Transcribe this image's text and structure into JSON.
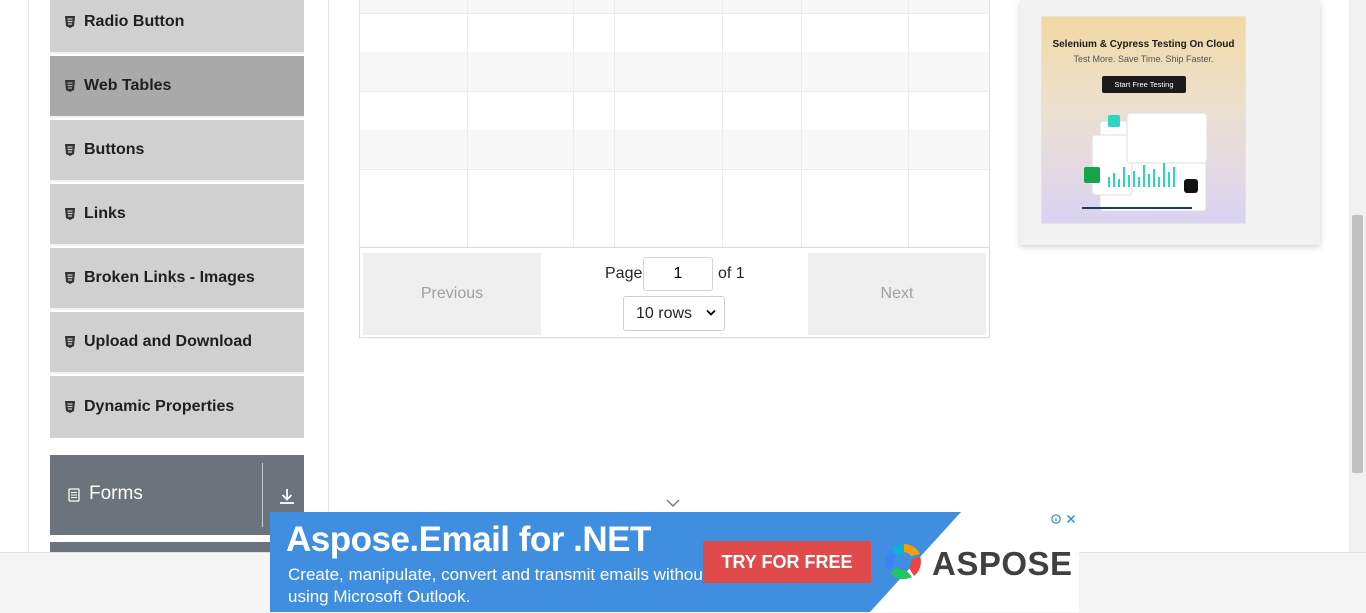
{
  "sidebar": {
    "items": [
      {
        "label": "Radio Button"
      },
      {
        "label": "Web Tables"
      },
      {
        "label": "Buttons"
      },
      {
        "label": "Links"
      },
      {
        "label": "Broken Links - Images"
      },
      {
        "label": "Upload and Download"
      },
      {
        "label": "Dynamic Properties"
      }
    ],
    "active_item": "Web Tables",
    "group": {
      "label": "Forms"
    }
  },
  "table": {
    "empty_rows": 7
  },
  "pagination": {
    "previous_label": "Previous",
    "next_label": "Next",
    "page_label": "Page",
    "current_page": "1",
    "of_label": "of 1",
    "rows_selected": "10 rows"
  },
  "side_ad": {
    "title": "Selenium & Cypress Testing On Cloud",
    "subtitle": "Test More. Save Time. Ship Faster.",
    "cta": "Start Free Testing"
  },
  "bottom_ad": {
    "title": "Aspose.Email for .NET",
    "description": "Create, manipulate, convert and transmit emails without using Microsoft Outlook.",
    "cta": "TRY FOR FREE",
    "brand": "ASPOSE"
  },
  "colors": {
    "sidebar_item": "#d0d0d0",
    "sidebar_active": "#a9a9a9",
    "group_header": "#6b737c",
    "ad_blue": "#3f8ee0",
    "ad_red": "#e04a4a"
  }
}
